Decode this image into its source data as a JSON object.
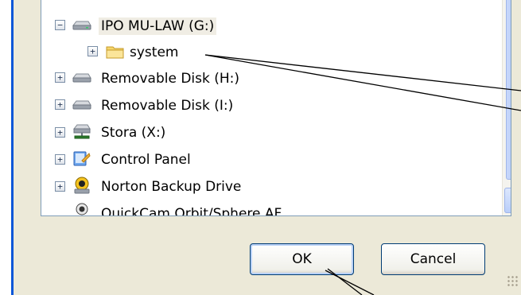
{
  "tree": {
    "items": [
      {
        "label": "IPO MU-LAW (G:)",
        "icon": "drive-icon",
        "expander": "−",
        "selected": true
      },
      {
        "label": "system",
        "icon": "folder-icon",
        "expander": "+"
      },
      {
        "label": "Removable Disk (H:)",
        "icon": "drive-icon",
        "expander": "+"
      },
      {
        "label": "Removable Disk (I:)",
        "icon": "drive-icon",
        "expander": "+"
      },
      {
        "label": "Stora (X:)",
        "icon": "network-drive-icon",
        "expander": "+"
      },
      {
        "label": "Control Panel",
        "icon": "control-panel-icon",
        "expander": "+"
      },
      {
        "label": "Norton Backup Drive",
        "icon": "norton-backup-icon",
        "expander": "+"
      },
      {
        "label": "QuickCam Orbit/Sphere AF",
        "icon": "webcam-icon",
        "expander": ""
      }
    ]
  },
  "buttons": {
    "ok_label": "OK",
    "cancel_label": "Cancel"
  },
  "colors": {
    "dialog_bg": "#ece9d8",
    "frame_blue": "#0a57d8",
    "scroll_thumb": "#b6cbf9",
    "button_border": "#003c74"
  }
}
